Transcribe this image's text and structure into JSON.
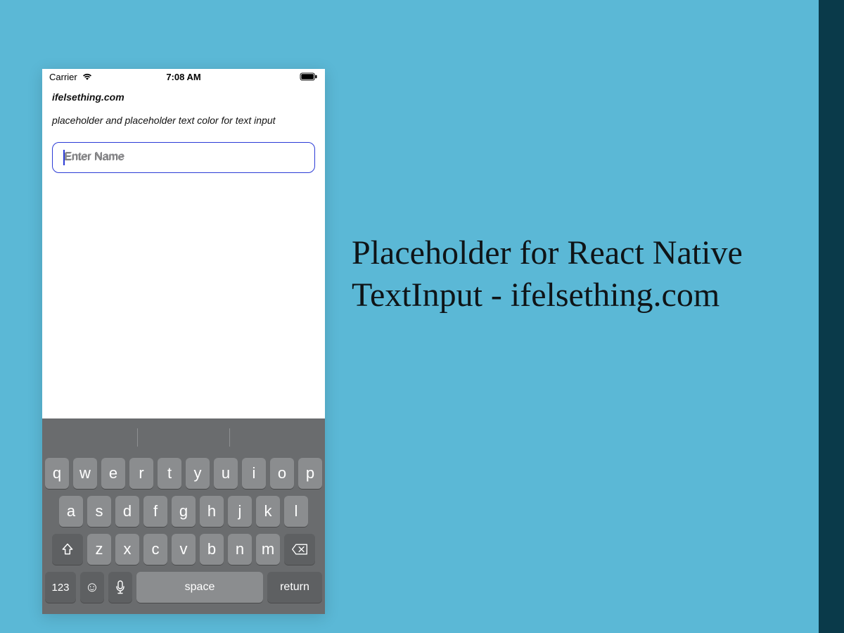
{
  "headline": "Placeholder for React Native TextInput - ifelsething.com",
  "phone": {
    "status": {
      "carrier": "Carrier",
      "time": "7:08 AM"
    },
    "content": {
      "site": "ifelsething.com",
      "description": "placeholder and placeholder text color for text input",
      "input_placeholder": "Enter Name"
    },
    "keyboard": {
      "row1": [
        "q",
        "w",
        "e",
        "r",
        "t",
        "y",
        "u",
        "i",
        "o",
        "p"
      ],
      "row2": [
        "a",
        "s",
        "d",
        "f",
        "g",
        "h",
        "j",
        "k",
        "l"
      ],
      "row3": [
        "z",
        "x",
        "c",
        "v",
        "b",
        "n",
        "m"
      ],
      "bottom": {
        "numbers": "123",
        "space": "space",
        "return": "return"
      }
    }
  }
}
